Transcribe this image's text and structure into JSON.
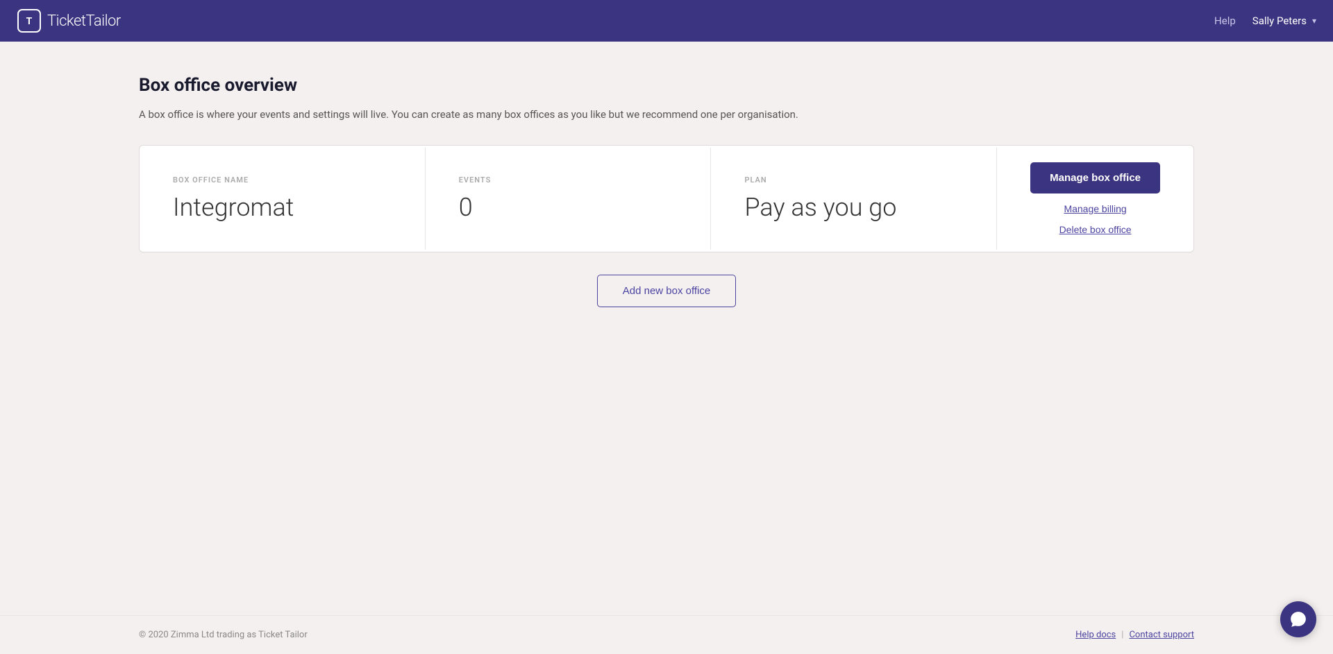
{
  "header": {
    "logo_text_bold": "Ticket",
    "logo_text_light": "Tailor",
    "help_label": "Help",
    "user_name": "Sally Peters"
  },
  "page": {
    "title": "Box office overview",
    "description": "A box office is where your events and settings will live. You can create as many box offices as you like but we recommend one per organisation."
  },
  "box_office": {
    "name_label": "BOX OFFICE NAME",
    "name_value": "Integromat",
    "events_label": "EVENTS",
    "events_value": "0",
    "plan_label": "PLAN",
    "plan_value": "Pay as you go",
    "manage_button_label": "Manage box office",
    "manage_billing_label": "Manage billing",
    "delete_label": "Delete box office"
  },
  "actions": {
    "add_new_label": "Add new box office"
  },
  "footer": {
    "copyright": "© 2020 Zimma Ltd trading as Ticket Tailor",
    "help_docs_label": "Help docs",
    "contact_support_label": "Contact support"
  }
}
